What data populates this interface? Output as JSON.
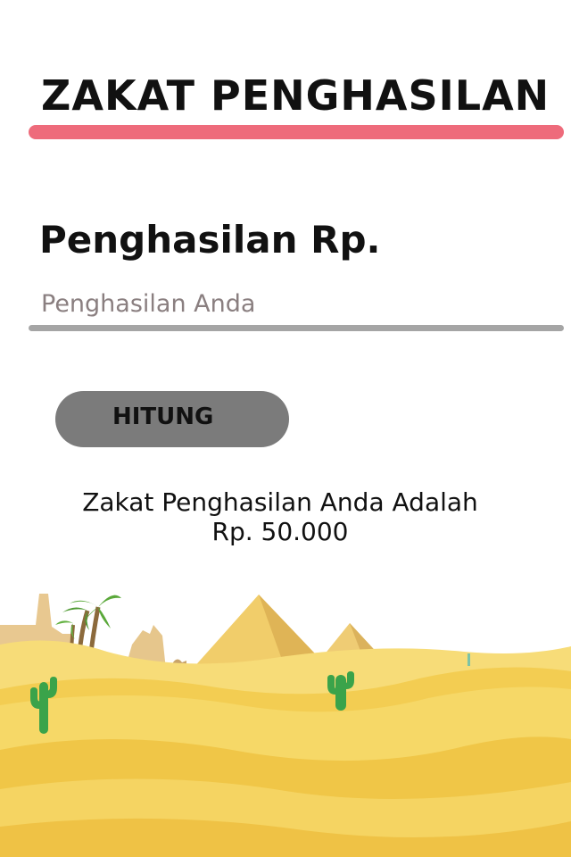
{
  "header": {
    "title": "ZAKAT PENGHASILAN"
  },
  "form": {
    "income_label": "Penghasilan Rp.",
    "income_value": "",
    "income_placeholder": "Penghasilan Anda",
    "calculate_label": "HITUNG"
  },
  "result": {
    "line1": "Zakat Penghasilan Anda Adalah",
    "line2": "Rp. 50.000"
  },
  "colors": {
    "accent_underline": "#ee6b7b",
    "button_bg": "#7b7b7b",
    "input_underline": "#a5a5a5"
  },
  "background": {
    "illustration": "desert-scene"
  }
}
